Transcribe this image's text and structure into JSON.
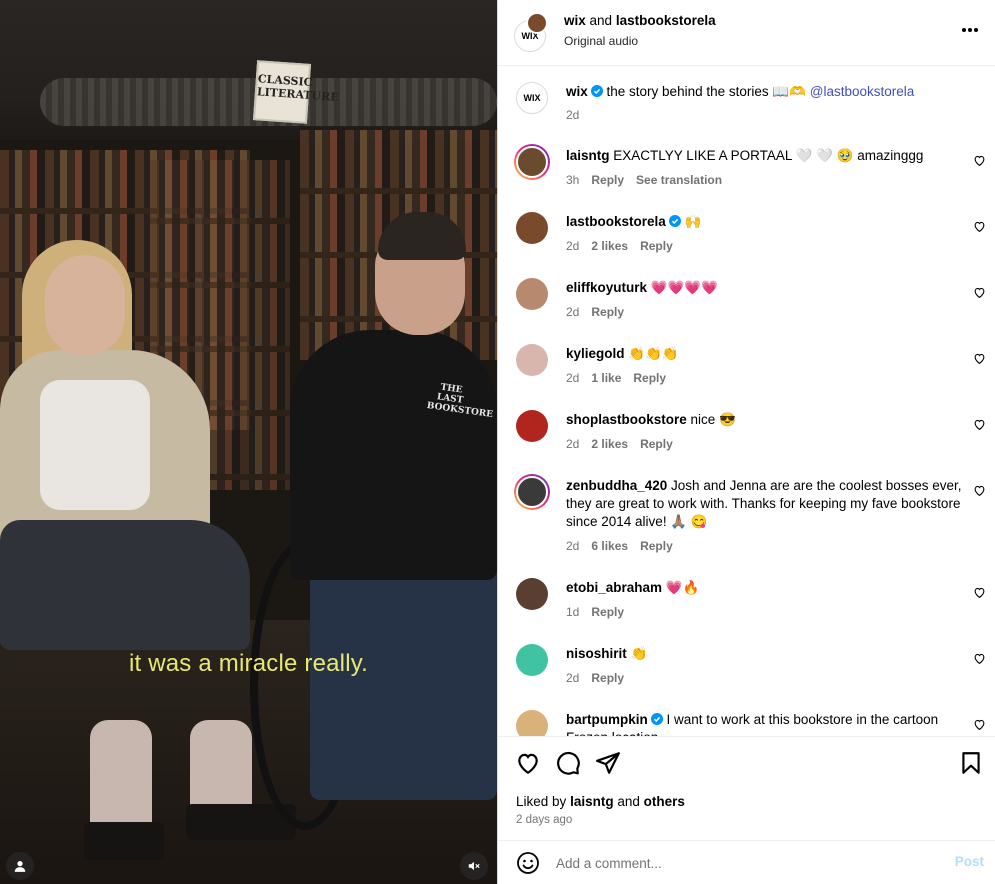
{
  "video": {
    "caption": "it was a miracle really.",
    "sign_text": "CLASSIC LITERATURE",
    "hoodie_text": "THE LAST BOOKSTORE",
    "icons": {
      "user": "user-icon",
      "mute": "volume-muted-icon"
    }
  },
  "header": {
    "title_user1": "wix",
    "title_and": "and",
    "title_user2": "lastbookstorela",
    "subtitle": "Original audio",
    "avatar_label": "WIX",
    "more_icon": "more-horizontal-icon"
  },
  "caption_post": {
    "user": "wix",
    "text": "the story behind the stories 📖🫶",
    "mention": "@lastbookstorela",
    "time": "2d",
    "avatar_label": "WIX"
  },
  "comments": [
    {
      "user": "laisntg",
      "verified": false,
      "text": "EXACTLYY LIKE A PORTAAL 🤍 🤍 🥹 amazinggg",
      "time": "3h",
      "likes": "",
      "reply": "Reply",
      "extra": "See translation",
      "avatar_color": "#6b4b2e",
      "ring": true
    },
    {
      "user": "lastbookstorela",
      "verified": true,
      "text": "🙌",
      "time": "2d",
      "likes": "2 likes",
      "reply": "Reply",
      "extra": "",
      "avatar_color": "#7a4a2d",
      "ring": false
    },
    {
      "user": "eliffkoyuturk",
      "verified": false,
      "text": "💗💗💗💗",
      "time": "2d",
      "likes": "",
      "reply": "Reply",
      "extra": "",
      "avatar_color": "#b78a70",
      "ring": false
    },
    {
      "user": "kyliegold",
      "verified": false,
      "text": "👏👏👏",
      "time": "2d",
      "likes": "1 like",
      "reply": "Reply",
      "extra": "",
      "avatar_color": "#d8b6ad",
      "ring": false
    },
    {
      "user": "shoplastbookstore",
      "verified": false,
      "text": "nice 😎",
      "time": "2d",
      "likes": "2 likes",
      "reply": "Reply",
      "extra": "",
      "avatar_color": "#b1251f",
      "ring": false
    },
    {
      "user": "zenbuddha_420",
      "verified": false,
      "text": "Josh and Jenna are are the coolest bosses ever, they are great to work with. Thanks for keeping my fave bookstore since 2014 alive! 🙏🏽 😋",
      "time": "2d",
      "likes": "6 likes",
      "reply": "Reply",
      "extra": "",
      "avatar_color": "#3a3a3a",
      "ring": true
    },
    {
      "user": "etobi_abraham",
      "verified": false,
      "text": "💗🔥",
      "time": "1d",
      "likes": "",
      "reply": "Reply",
      "extra": "",
      "avatar_color": "#5a3e32",
      "ring": false
    },
    {
      "user": "nisoshirit",
      "verified": false,
      "text": "👏",
      "time": "2d",
      "likes": "",
      "reply": "Reply",
      "extra": "",
      "avatar_color": "#3fc3a3",
      "ring": false
    },
    {
      "user": "bartpumpkin",
      "verified": true,
      "text": "I want to work at this bookstore in the cartoon Frozen location",
      "time": "",
      "likes": "",
      "reply": "",
      "extra": "",
      "avatar_color": "#d9b27a",
      "ring": false
    }
  ],
  "actions": {
    "likes_prefix": "Liked by",
    "likes_user": "laisntg",
    "likes_and": "and",
    "likes_others": "others",
    "date": "2 days ago",
    "icons": [
      "heart-icon",
      "comment-icon",
      "share-icon",
      "bookmark-icon"
    ]
  },
  "add_comment": {
    "placeholder": "Add a comment...",
    "post_label": "Post",
    "emoji_icon": "emoji-icon"
  },
  "colors": {
    "verified": "#0095f6",
    "link": "#4150b5",
    "post_disabled": "#b2dffc",
    "caption": "#e8e96f"
  }
}
